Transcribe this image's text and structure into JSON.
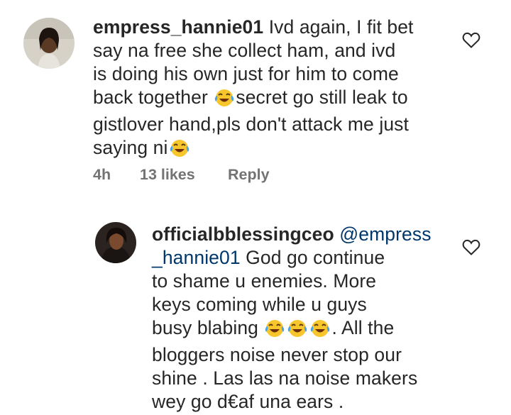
{
  "comments": [
    {
      "username": "empress_hannie01",
      "lines": [
        "Ivd again, I fit bet",
        "say na free she collect ham, and ivd",
        "is doing his own just for him to come",
        "back together",
        "secret go still leak to",
        "gistlover hand,pls don't attack me just",
        "saying ni"
      ],
      "time": "4h",
      "likes": "13 likes",
      "reply_label": "Reply"
    },
    {
      "username": "officialbblessingceo",
      "mention": "@empress",
      "lines": [
        "_hannie01",
        "God go continue",
        "to shame u enemies. More",
        "keys coming while u guys",
        "busy blabing",
        ". All the",
        "bloggers noise never stop our",
        "shine . Las las na noise makers",
        "wey go d€af una ears ."
      ]
    }
  ],
  "icons": {
    "like": "heart-outline-icon",
    "emoji": "face-with-tears-of-joy-icon"
  },
  "colors": {
    "text": "#262626",
    "mention": "#00376b",
    "meta": "#737373"
  }
}
